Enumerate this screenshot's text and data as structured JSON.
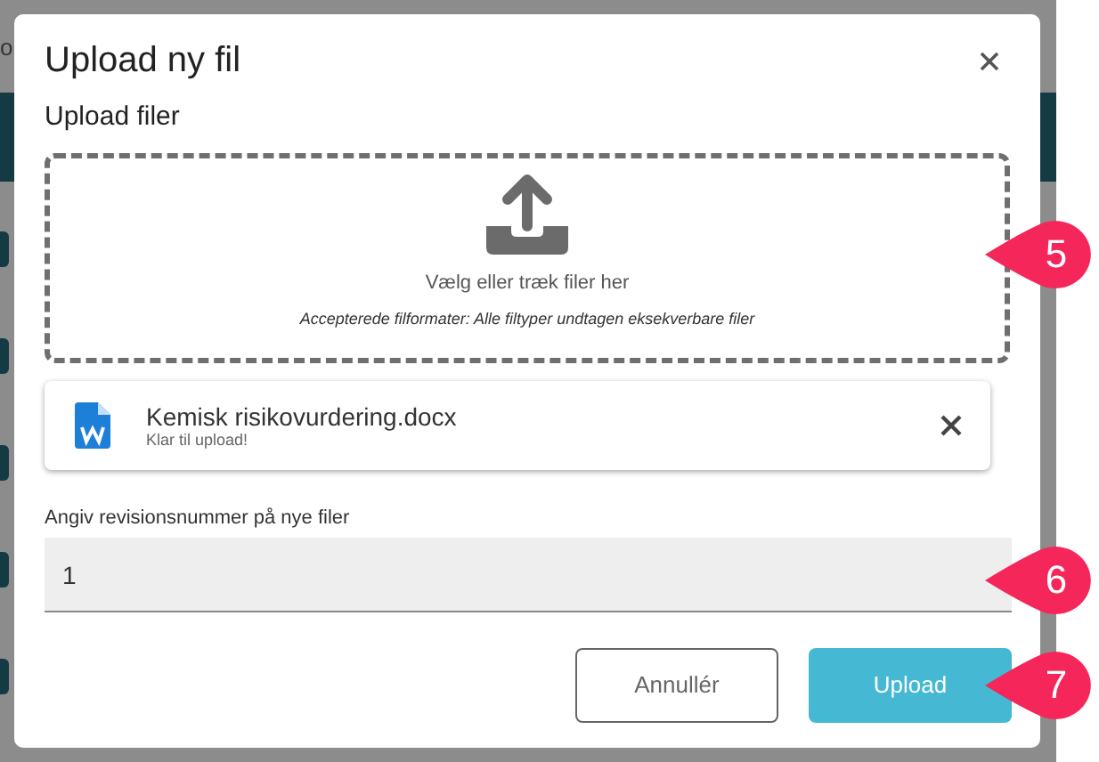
{
  "background": {
    "partial_text": "o"
  },
  "dialog": {
    "title": "Upload ny fil",
    "section_title": "Upload filer",
    "dropzone": {
      "prompt": "Vælg eller træk filer her",
      "accepted_formats": "Accepterede filformater: Alle filtyper undtagen eksekverbare filer"
    },
    "files": [
      {
        "name": "Kemisk risikovurdering.docx",
        "status": "Klar til upload!"
      }
    ],
    "revision": {
      "label": "Angiv revisionsnummer på nye filer",
      "value": "1"
    },
    "buttons": [
      {
        "label": "Annullér",
        "kind": "outline"
      },
      {
        "label": "Upload",
        "kind": "primary"
      }
    ]
  },
  "callouts": [
    {
      "label": "5"
    },
    {
      "label": "6"
    },
    {
      "label": "7"
    }
  ]
}
